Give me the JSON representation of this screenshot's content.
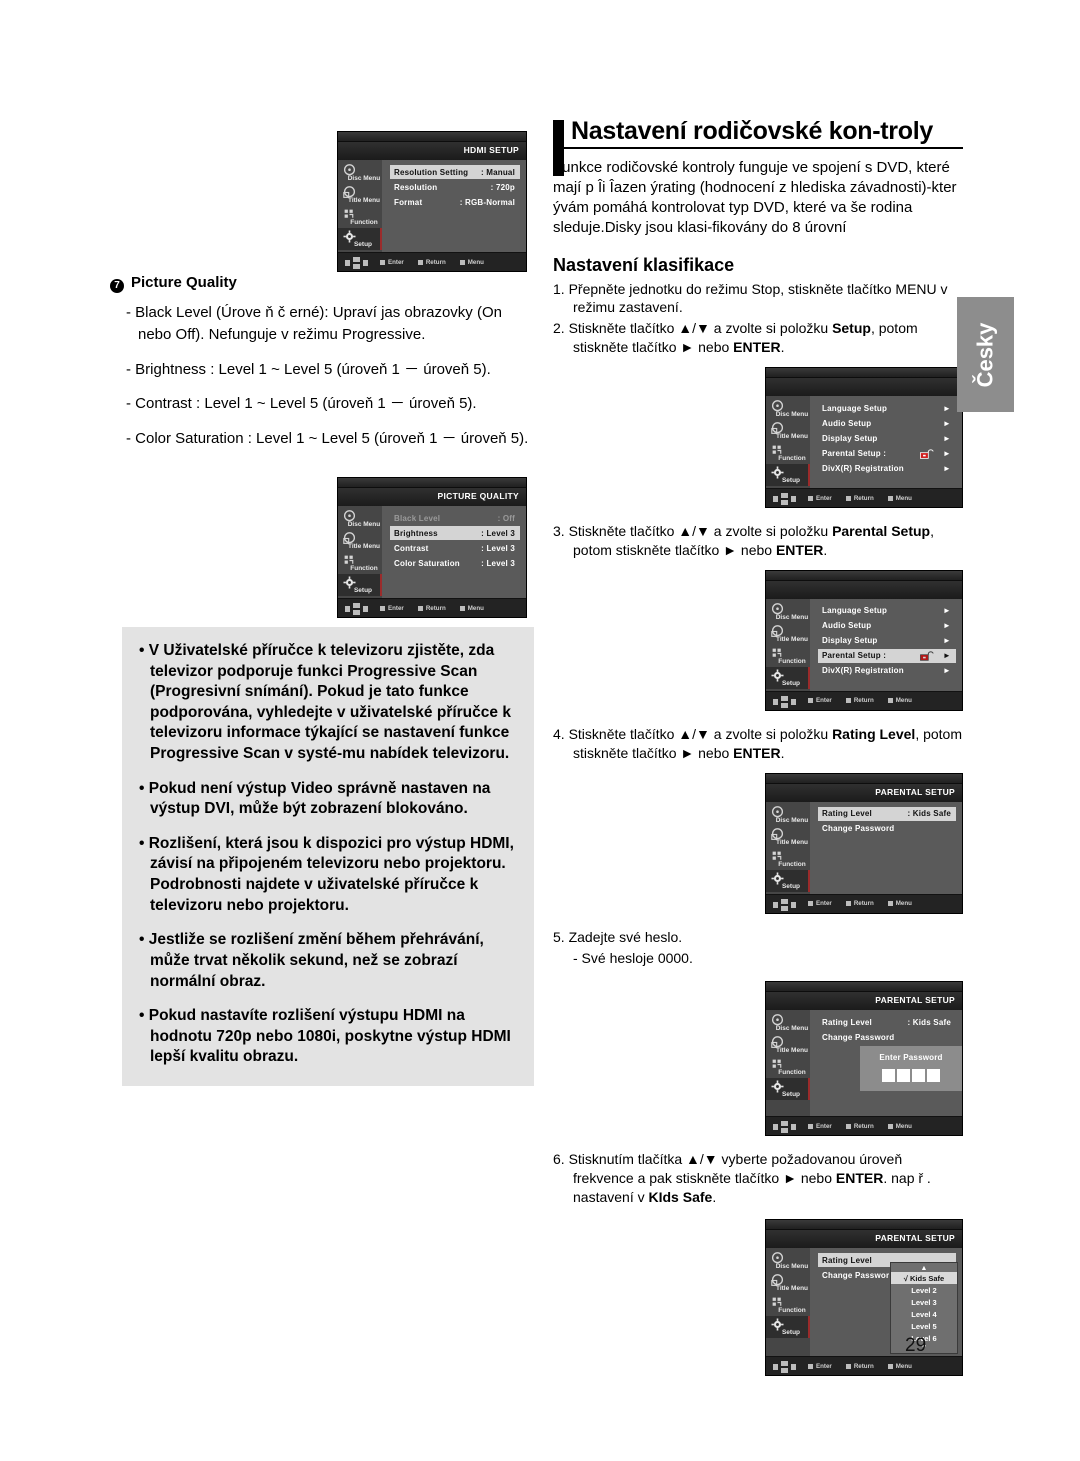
{
  "page": {
    "number": "29",
    "language_tab": "Česky"
  },
  "left": {
    "hdmi_setup_osd": {
      "title": "HDMI SETUP",
      "sidebar": [
        "Disc Menu",
        "Title Menu",
        "Function",
        "Setup"
      ],
      "rows": [
        {
          "label": "Resolution Setting",
          "value": ": Manual",
          "selected": true
        },
        {
          "label": "Resolution",
          "value": ": 720p",
          "selected": false
        },
        {
          "label": "Format",
          "value": ": RGB-Normal",
          "selected": false
        }
      ],
      "bottom": [
        "Enter",
        "Return",
        "Menu"
      ]
    },
    "picture_quality": {
      "number": "7",
      "heading": "Picture Quality",
      "bullets": [
        "- Black Level (Úrove ň č erné): Upraví jas obrazovky (On nebo Off). Nefunguje v režimu Progressive.",
        "- Brightness : Level 1 ~ Level 5 (úroveň 1 － úroveň 5).",
        "- Contrast : Level 1 ~ Level 5 (úroveň 1 － úroveň 5).",
        "- Color Saturation : Level 1 ~ Level 5 (úroveň 1 － úroveň 5)."
      ]
    },
    "picture_quality_osd": {
      "title": "PICTURE QUALITY",
      "sidebar": [
        "Disc Menu",
        "Title Menu",
        "Function",
        "Setup"
      ],
      "rows": [
        {
          "label": "Black Level",
          "value": ": Off",
          "dim": true,
          "selected": false
        },
        {
          "label": "Brightness",
          "value": ": Level 3",
          "dim": false,
          "selected": true
        },
        {
          "label": "Contrast",
          "value": ": Level 3",
          "dim": false,
          "selected": false
        },
        {
          "label": "Color Saturation",
          "value": ": Level 3",
          "dim": false,
          "selected": false
        }
      ],
      "bottom": [
        "Enter",
        "Return",
        "Menu"
      ]
    },
    "notes": [
      "• V Uživatelské příručce k televizoru zjistěte, zda televizor podporuje funkci Progressive Scan (Progresivní snímání). Pokud je tato funkce podporována, vyhledejte v uživatelské příručce k televizoru informace týkající se nastavení funkce Progressive Scan v systé-mu nabídek televizoru.",
      "• Pokud není výstup Video správně nastaven na výstup DVI, může být zobrazení blokováno.",
      "• Rozlišení, která jsou k dispozici pro výstup HDMI, závisí na připojeném televizoru nebo projektoru. Podrobnosti najdete v uživatelské příručce k televizoru nebo projektoru.",
      "• Jestliže se rozlišení změní během přehrávání, může trvat několik sekund, než se zobrazí normální obraz.",
      "• Pokud nastavíte rozlišení výstupu HDMI na hodnotu 720p nebo 1080i, poskytne výstup HDMI lepší kvalitu obrazu."
    ]
  },
  "right": {
    "title": "Nastavení rodičovské kon-troly",
    "intro": "Funkce rodičovské kontroly funguje ve spojení s DVD, které mají p Îi Îazen ýrating (hodnocení z hlediska závadnosti)-kter ývám pomáhá kontrolovat typ DVD, které va še rodina sleduje.Disky jsou klasi-fikovány do 8 úrovní",
    "sub_title": "Nastavení klasifikace",
    "steps": {
      "s1": "1. Přepněte jednotku do režimu Stop, stiskněte tlačítko MENU v režimu zastavení.",
      "s2_a": "2. Stiskněte tlačítko ▲/▼ a zvolte si položku ",
      "s2_b": "Setup",
      "s2_c": ", potom stiskněte tlačítko ► nebo ",
      "s2_d": "ENTER",
      "s2_e": ".",
      "s3_a": "3. Stiskněte tlačítko ▲/▼ a zvolte si položku ",
      "s3_b": "Parental Setup",
      "s3_c": ", potom stiskněte tlačítko ► nebo ",
      "s3_d": "ENTER",
      "s3_e": ".",
      "s4_a": "4. Stiskněte tlačítko ▲/▼ a zvolte si položku ",
      "s4_b": "Rating Level",
      "s4_c": ", potom stiskněte tlačítko ► nebo ",
      "s4_d": "ENTER",
      "s4_e": ".",
      "s5": "5. Zadejte své heslo.",
      "s5_sub": "- Své hesloje 0000.",
      "s6_a": "6. Stisknutím tlačítka ▲/▼ vyberte požadovanou úroveň frekvence a pak stiskněte tlačítko ► nebo ",
      "s6_b": "ENTER",
      "s6_c": ". nap ř . nastavení v ",
      "s6_d": "KIds Safe",
      "s6_e": "."
    },
    "setup_osd_1": {
      "title": "",
      "sidebar": [
        "Disc Menu",
        "Title Menu",
        "Function",
        "Setup"
      ],
      "rows": [
        {
          "label": "Language Setup",
          "value": "",
          "arrow": "►",
          "selected": false
        },
        {
          "label": "Audio Setup",
          "value": "",
          "arrow": "►",
          "selected": false
        },
        {
          "label": "Display Setup",
          "value": "",
          "arrow": "►",
          "selected": false
        },
        {
          "label": "Parental Setup :",
          "value": "lock-icon",
          "arrow": "►",
          "selected": false
        },
        {
          "label": "DivX(R) Registration",
          "value": "",
          "arrow": "►",
          "selected": false
        }
      ],
      "bottom": [
        "Enter",
        "Return",
        "Menu"
      ]
    },
    "setup_osd_2": {
      "title": "",
      "sidebar": [
        "Disc Menu",
        "Title Menu",
        "Function",
        "Setup"
      ],
      "rows": [
        {
          "label": "Language Setup",
          "value": "",
          "arrow": "►",
          "selected": false
        },
        {
          "label": "Audio Setup",
          "value": "",
          "arrow": "►",
          "selected": false
        },
        {
          "label": "Display Setup",
          "value": "",
          "arrow": "►",
          "selected": false
        },
        {
          "label": "Parental Setup :",
          "value": "lock-icon",
          "arrow": "►",
          "selected": true
        },
        {
          "label": "DivX(R) Registration",
          "value": "",
          "arrow": "►",
          "selected": false
        }
      ],
      "bottom": [
        "Enter",
        "Return",
        "Menu"
      ]
    },
    "parental_osd_1": {
      "title": "PARENTAL SETUP",
      "sidebar": [
        "Disc Menu",
        "Title Menu",
        "Function",
        "Setup"
      ],
      "rows": [
        {
          "label": "Rating Level",
          "value": ": Kids Safe",
          "selected": true
        },
        {
          "label": "Change Password",
          "value": "",
          "selected": false
        }
      ],
      "bottom": [
        "Enter",
        "Return",
        "Menu"
      ]
    },
    "parental_osd_2": {
      "title": "PARENTAL SETUP",
      "sidebar": [
        "Disc Menu",
        "Title Menu",
        "Function",
        "Setup"
      ],
      "rows": [
        {
          "label": "Rating Level",
          "value": ": Kids Safe",
          "selected": false
        },
        {
          "label": "Change Password",
          "value": "",
          "selected": false
        }
      ],
      "dialog": {
        "title": "Enter Password",
        "boxes": 4
      },
      "bottom": [
        "Enter",
        "Return",
        "Menu"
      ]
    },
    "parental_osd_3": {
      "title": "PARENTAL SETUP",
      "sidebar": [
        "Disc Menu",
        "Title Menu",
        "Function",
        "Setup"
      ],
      "rows": [
        {
          "label": "Rating Level",
          "value": "",
          "selected": true
        },
        {
          "label": "Change Passwor",
          "value": "",
          "selected": false
        }
      ],
      "dropdown": {
        "up": "▲",
        "down": "▼",
        "items": [
          {
            "label": "√  Kids Safe",
            "selected": true
          },
          {
            "label": "Level 2",
            "selected": false
          },
          {
            "label": "Level 3",
            "selected": false
          },
          {
            "label": "Level 4",
            "selected": false
          },
          {
            "label": "Level 5",
            "selected": false
          },
          {
            "label": "Level 6",
            "selected": false
          }
        ]
      },
      "bottom": [
        "Enter",
        "Return",
        "Menu"
      ]
    }
  }
}
